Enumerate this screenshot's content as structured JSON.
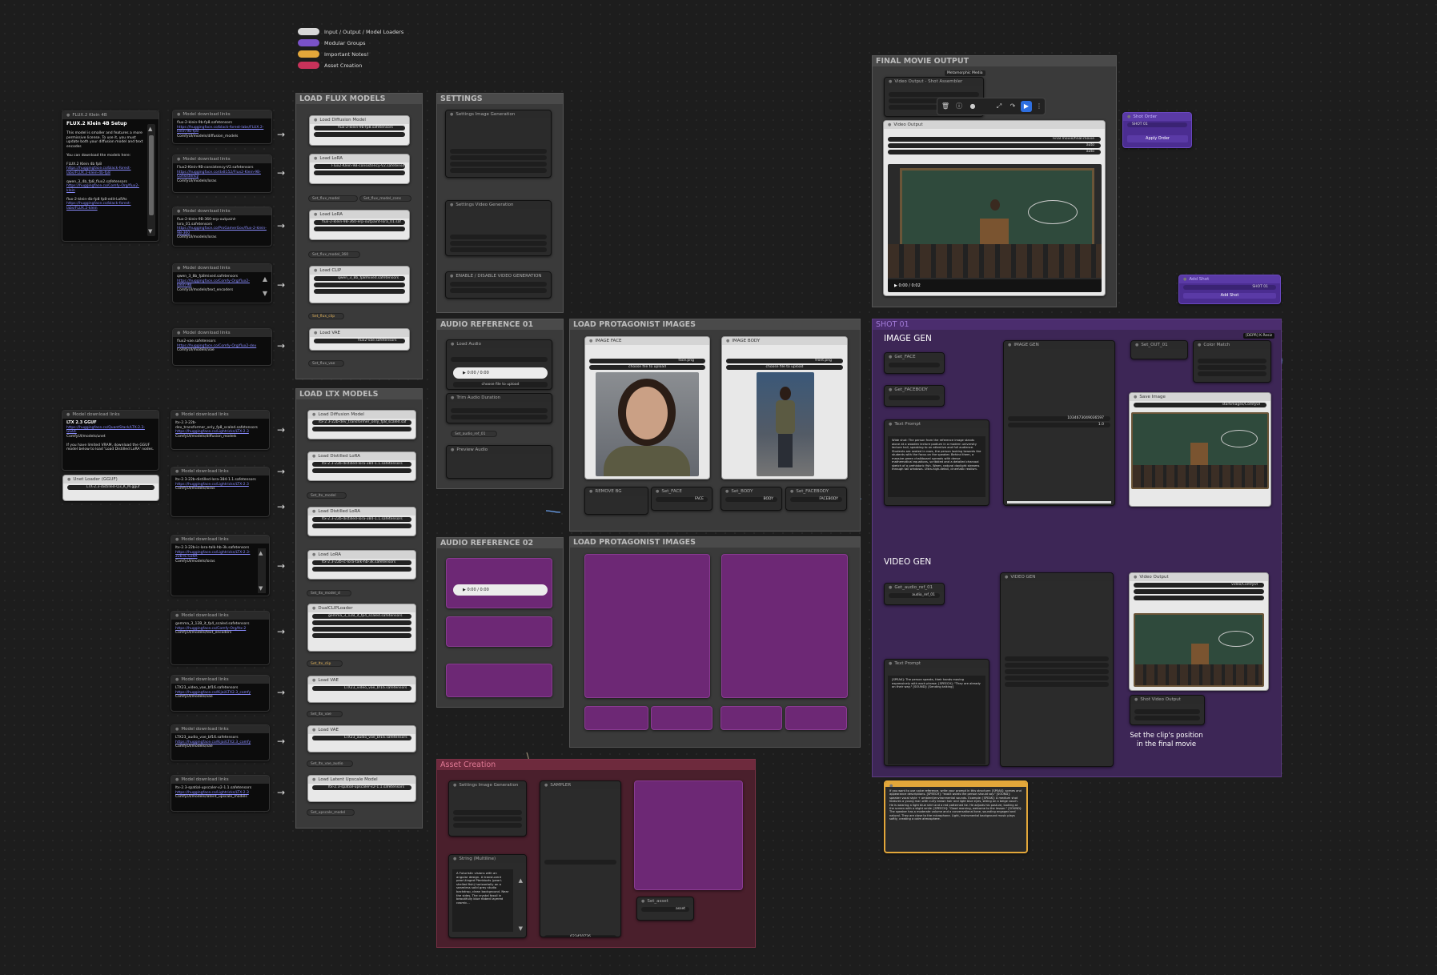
{
  "legend": [
    {
      "label": "Input / Output / Model Loaders",
      "color": "#d8d8d8"
    },
    {
      "label": "Modular Groups",
      "color": "#7a52c9"
    },
    {
      "label": "Important Notes!",
      "color": "#e3a73a"
    },
    {
      "label": "Asset Creation",
      "color": "#c8325a"
    }
  ],
  "groups": {
    "flux": "LOAD FLUX MODELS",
    "ltx": "LOAD LTX MODELS",
    "settings": "SETTINGS",
    "audio1": "AUDIO REFERENCE 01",
    "audio2": "AUDIO REFERENCE 02",
    "protag1": "LOAD PROTAGONIST IMAGES",
    "protag2": "LOAD PROTAGONIST IMAGES",
    "asset": "Asset Creation",
    "final": "FINAL MOVIE OUTPUT",
    "shot": "SHOT 01"
  },
  "flux_note": {
    "header": "FLUX.2 Klein 4B",
    "title": "FLUX.2 Klein 4B Setup",
    "body": "This model is smaller and features a more permissive license. To use it, you must update both your diffusion model and text encoder.",
    "sub": "You can download the models here:",
    "item1": "FLUX.2 Klein 4b fp8",
    "item2": "qwen_3_4b_fp8_flux2.safetensors",
    "item3": "flux-2-klein-4b-fp8 fp8-edit-LoRAs"
  },
  "model_download": "Model download links",
  "ltx_note": {
    "header": "Model download links",
    "title": "LTX 2.3 GGUF",
    "body": "If you have limited VRAM, download the GGUF model below to load 'Load Distilled LoRA' nodes."
  },
  "unet_loader": {
    "title": "Unet Loader (GGUF)",
    "value": "LTX-2.3-distilled-Q3_K_M.gguf"
  },
  "flux_nodes": [
    {
      "title": "Load Diffusion Model",
      "value": "flux-2-klein-9b-fp8.safetensors"
    },
    {
      "title": "Load LoRA",
      "value": "Flux2-Klein-9B-consistency-V2.safetensors"
    },
    {
      "title": "Load LoRA",
      "value": "flux-2-klein-9B-360-erp-outpaint-lora_01.saf"
    },
    {
      "title": "Load CLIP",
      "value": "qwen_3_8b_fp8mixed.safetensors"
    },
    {
      "title": "Load VAE",
      "value": "flux2-vae.safetensors"
    }
  ],
  "flux_setters": [
    "Set_flux_model",
    "Set_flux_model_cons",
    "Set_flux_model_360",
    "Set_flux_clip",
    "Set_flux_vae"
  ],
  "ltx_nodes": [
    {
      "title": "Load Diffusion Model",
      "value": "ltx-2.3-22b-dev_transformer_only_fp8_scaled.saf"
    },
    {
      "title": "Load Distilled LoRA",
      "value": "ltx-2.3-22b-distilled-lora-384-1.1.safetensors"
    },
    {
      "title": "Load Distilled LoRA",
      "value": "ltx-2.3-22b-distilled-lora-384-1.1.safetensors"
    },
    {
      "title": "Load LoRA",
      "value": "ltx-2.3-22b-ic-lora-talk-hb-3k.safetensors"
    },
    {
      "title": "DualCLIPLoader",
      "value": "gemma_3_12B_it_fp4_scaled.safetensors"
    },
    {
      "title": "Load VAE",
      "value": "LTX23_video_vae_bf16.safetensors"
    },
    {
      "title": "Load VAE",
      "value": "LTX23_audio_vae_bf16.safetensors"
    },
    {
      "title": "Load Latent Upscale Model",
      "value": "ltx-2.3-spatial-upscaler-x2-1.1.safetensors"
    }
  ],
  "ltx_setters": [
    "Set_ltx_model",
    "Set_ltx_model_d",
    "Set_ltx_clip",
    "Set_ltx_vae",
    "Set_ltx_vae_audio",
    "Set_upscale_model"
  ],
  "settings": {
    "image_title": "Settings Image Generation",
    "video_title": "Settings Video Generation",
    "image_rows": [
      [
        "resolution",
        "1152p"
      ],
      [
        "aspect_ratio",
        "16:9"
      ],
      [
        "steps",
        "4"
      ],
      [
        "CFG",
        "1.0"
      ]
    ],
    "video_rows": [
      [
        "resolution",
        "720p"
      ],
      [
        "aspect_ratio",
        "16:9"
      ],
      [
        "frame_rate",
        "24"
      ]
    ],
    "enable_title": "ENABLE / DISABLE VIDEO GENERATION",
    "enable_rows": [
      [
        "Video Output",
        "true"
      ],
      [
        "Modes - Anabilities",
        "false"
      ]
    ]
  },
  "audio1": {
    "load": "Load Audio",
    "file": "bstella_ref.mp3",
    "time": "0:00 / 0:00",
    "upload": "choose file to upload",
    "trim": "Trim Audio Duration",
    "trim_rows": [
      [
        "start_index",
        "0.00"
      ],
      [
        "duration",
        "6.00"
      ]
    ],
    "set": "Set_audio_ref_01",
    "preview": "Preview Audio"
  },
  "audio2": {
    "time": "0:00 / 0:00"
  },
  "protag1": {
    "face_title": "IMAGE FACE",
    "face_file": "face.png",
    "body_title": "IMAGE BODY",
    "body_file": "front.png",
    "upload": "choose file to upload",
    "remove_bg": "REMOVE BG",
    "set_face": "Set_FACE",
    "set_body": "Set_BODY",
    "set_facebody": "Set_FACEBODY",
    "const_face": "FACE",
    "const_body": "BODY",
    "const_facebody": "FACEBODY"
  },
  "asset": {
    "settings": "Settings Image Generation",
    "sampler": "SAMPLER",
    "string": "String (Multiline)",
    "prompt": "A Futuristic visions with an angular design. A translucent pearl-tinged Pteridocts (pearl-shelled fish) horizontally on a seamless solid grey studio backdrop, clean background. Near the sides. The crystal fossil in beautifully blue ribbed layered cosmic...",
    "set_asset": "Set_asset",
    "asset_const": "asset",
    "seed": "623450726",
    "rows": [
      [
        "resolution",
        "1152p"
      ],
      [
        "aspect_ratio",
        "16:9"
      ],
      [
        "steps",
        "4"
      ],
      [
        "CFG",
        "1.0"
      ]
    ]
  },
  "final": {
    "badge": "Metamorphic Media",
    "assembler": "Video Output - Shot Assembler",
    "rows": [
      [
        "resolution_mode",
        "auto"
      ],
      [
        "save_individual_shots",
        "true"
      ],
      [
        "clobber",
        "true"
      ]
    ],
    "video_title": "Video Output",
    "video_rows": [
      [
        "filename_prefix",
        "Final movie/final-movie"
      ],
      [
        "format",
        "auto"
      ],
      [
        "codec",
        "auto"
      ]
    ],
    "time": "0:00 / 0:02"
  },
  "shot_order": {
    "header": "Shot Order",
    "item": "SHOT 01",
    "button": "Apply Order"
  },
  "add_shot": {
    "header": "Add Shot",
    "row": "SHOT 01",
    "button": "Add Shot"
  },
  "shot01": {
    "image_gen": "IMAGE GEN",
    "video_gen": "VIDEO GEN",
    "badge": "[DEPR] K.Resiz",
    "get_face": "Get_FACE",
    "get_facebody": "Get_FACEBODY",
    "text_prompt": "Text Prompt",
    "prompt1": "Wide shot: The person from the reference image stands alone at a wooden lecture podium in a modern university lecture hall, speaking to an attentive and full audience. Students are seated in rows, the person looking towards the students with the focus on the speaker. Behind them, a massive green chalkboard spreads with dense mathematical equations, scribbled and a detailed charcoal sketch of a prehistoric fish. Warm, natural daylight streams through tall windows. Ultra-high-detail, cinematic realism.",
    "image_gen_node": "IMAGE GEN",
    "seed": "1034673049036597",
    "guidance": "1.0",
    "set_out": "Set_OUT_01",
    "color_match": "Color Match",
    "save_image": "Save Image",
    "save_prefix": "startimages/ComfyUI",
    "get_audio": "Get_audio_ref_01",
    "audio_const": "audio_ref_01",
    "prompt2": "[SPEAK]: The person speaks, their hands moving expressively with each phrase. [SPEECH]: \"They are already on their way.\" [SOUND]: [Sending talking]",
    "video_gen_node": "VIDEO GEN",
    "video_output": "Video Output",
    "video_prefix": "video/ComfyUI",
    "shot_output": "Shot Video Output",
    "shot_rows": [
      [
        "shot_position",
        "1"
      ],
      [
        "enabled",
        "true"
      ]
    ],
    "caption": "Set the clip's position in the final movie"
  },
  "important_note": "If you want to use voice reference, write your prompt in this structure: [SPEAK]: scenes and appearance descriptions. [SPEECH]: \"exact words the person should say.\" [SOUND]: speaker vocal style + ambient/environmental sounds. Example: [SPEAK]: A medium shot features a young man with curly brown hair and light blue eyes, sitting on a beige couch. He is wearing a light blue shirt and a red patterned tie. He adjusts his posture, looking at the screen with a slight smile. [SPEECH]: \"Good morning, welcome to the lesson.\" [SOUND]: The speaker has a moderate volume and a conversational tone, sounding engaged and natural. They are close to the microphone. Light, instrumental background music plays softly, creating a calm atmosphere."
}
